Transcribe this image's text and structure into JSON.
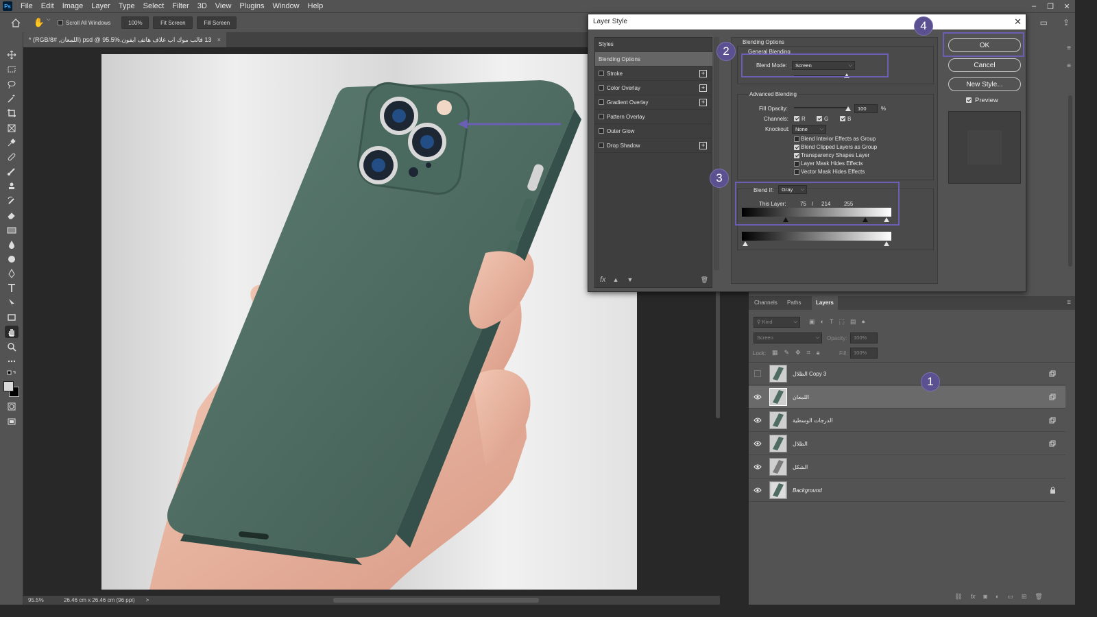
{
  "app": {
    "logo": "Ps",
    "menu": [
      "File",
      "Edit",
      "Image",
      "Layer",
      "Type",
      "Select",
      "Filter",
      "3D",
      "View",
      "Plugins",
      "Window",
      "Help"
    ]
  },
  "options": {
    "scroll_all": "Scroll All Windows",
    "zoom": "100%",
    "fit": "Fit Screen",
    "fill": "Fill Screen"
  },
  "document": {
    "tab_title": "13 قالب موك اب غلاف هاتف ايفون.psd @ 95.5% (اللمعان, RGB/8#) *",
    "tab_close": "×"
  },
  "status": {
    "zoom": "95.5%",
    "size": "26.46 cm x 26.46 cm (96 ppi)",
    "arrow": ">"
  },
  "dialog": {
    "title": "Layer Style",
    "close": "✕",
    "styles_header": "Styles",
    "styles": [
      {
        "label": "Blending Options",
        "checkbox": false,
        "plus": false,
        "selected": true
      },
      {
        "label": "Stroke",
        "checkbox": true,
        "plus": true
      },
      {
        "label": "Color Overlay",
        "checkbox": true,
        "plus": true
      },
      {
        "label": "Gradient Overlay",
        "checkbox": true,
        "plus": true
      },
      {
        "label": "Pattern Overlay",
        "checkbox": true,
        "plus": false
      },
      {
        "label": "Outer Glow",
        "checkbox": true,
        "plus": false
      },
      {
        "label": "Drop Shadow",
        "checkbox": true,
        "plus": true
      }
    ],
    "fx": "fx",
    "blending_options": "Blending Options",
    "general_blending": "General Blending",
    "blend_mode_label": "Blend Mode:",
    "blend_mode": "Screen",
    "advanced_blending": "Advanced Blending",
    "fill_opacity_label": "Fill Opacity:",
    "fill_opacity": "100",
    "percent": "%",
    "channels_label": "Channels:",
    "ch_r": "R",
    "ch_g": "G",
    "ch_b": "B",
    "knockout_label": "Knockout:",
    "knockout": "None",
    "adv_options": [
      {
        "label": "Blend Interior Effects as Group",
        "checked": false
      },
      {
        "label": "Blend Clipped Layers as Group",
        "checked": true
      },
      {
        "label": "Transparency Shapes Layer",
        "checked": true
      },
      {
        "label": "Layer Mask Hides Effects",
        "checked": false
      },
      {
        "label": "Vector Mask Hides Effects",
        "checked": false
      }
    ],
    "blend_if_label": "Blend If:",
    "blend_if": "Gray",
    "this_layer_label": "This Layer:",
    "this_layer_v1": "75",
    "slash": "/",
    "this_layer_v2": "214",
    "this_layer_v3": "255",
    "ok": "OK",
    "cancel": "Cancel",
    "new_style": "New Style...",
    "preview": "Preview"
  },
  "callouts": {
    "c1": "1",
    "c2": "2",
    "c3": "3",
    "c4": "4"
  },
  "layers_panel": {
    "tabs": [
      "Channels",
      "Paths",
      "Layers"
    ],
    "kind": "Kind",
    "blend": "Screen",
    "opacity_label": "Opacity:",
    "opacity": "100%",
    "lock_label": "Lock:",
    "fill_label": "Fill:",
    "fill": "100%",
    "layers": [
      {
        "name": "الظلال Copy 3",
        "visible": false,
        "selected": false,
        "italic": false,
        "icon": "link"
      },
      {
        "name": "اللمعان",
        "visible": true,
        "selected": true,
        "italic": false,
        "icon": "link"
      },
      {
        "name": "الدرجات الوسطية",
        "visible": true,
        "selected": false,
        "italic": false,
        "icon": "link"
      },
      {
        "name": "الظلال",
        "visible": true,
        "selected": false,
        "italic": false,
        "icon": "link"
      },
      {
        "name": "الشكل",
        "visible": true,
        "selected": false,
        "italic": false,
        "icon": "none"
      },
      {
        "name": "Background",
        "visible": true,
        "selected": false,
        "italic": true,
        "icon": "lock"
      }
    ]
  },
  "colors": {
    "accent": "#5b5190",
    "phone": "#4e6c62"
  }
}
